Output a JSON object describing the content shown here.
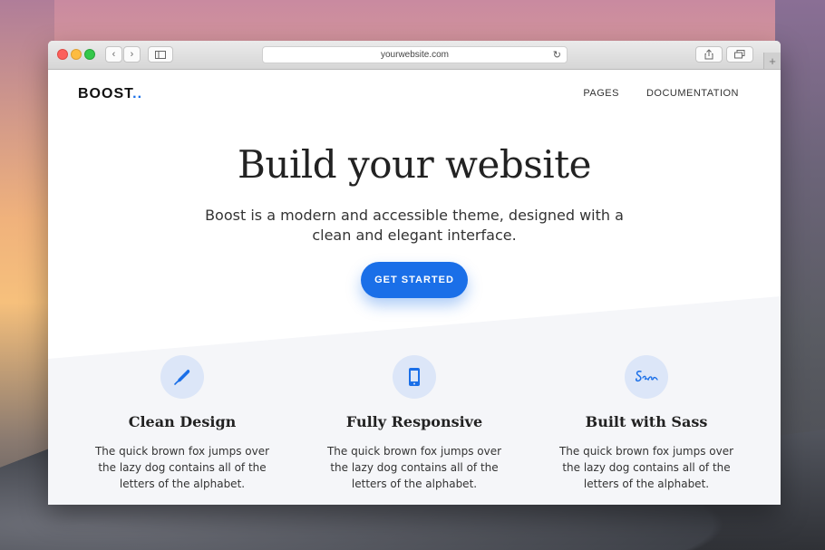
{
  "browser": {
    "url": "yourwebsite.com",
    "back_label": "‹",
    "forward_label": "›",
    "newtab_label": "+"
  },
  "site": {
    "logo_text": "BOOST",
    "logo_dots": "..",
    "nav": [
      {
        "label": "PAGES"
      },
      {
        "label": "DOCUMENTATION"
      }
    ]
  },
  "hero": {
    "title": "Build your website",
    "subtitle": "Boost is a modern and accessible theme, designed with a clean and elegant interface.",
    "cta_label": "GET STARTED"
  },
  "features": [
    {
      "icon": "pen-icon",
      "title": "Clean Design",
      "text": "The quick brown fox jumps over the lazy dog contains all of the letters of the alphabet."
    },
    {
      "icon": "mobile-icon",
      "title": "Fully Responsive",
      "text": "The quick brown fox jumps over the lazy dog contains all of the letters of the alphabet."
    },
    {
      "icon": "sass-icon",
      "title": "Built with Sass",
      "text": "The quick brown fox jumps over the lazy dog contains all of the letters of the alphabet."
    }
  ],
  "colors": {
    "accent": "#1a6fe8",
    "icon_bg": "#dce6f8",
    "section_bg": "#f5f6f9"
  }
}
